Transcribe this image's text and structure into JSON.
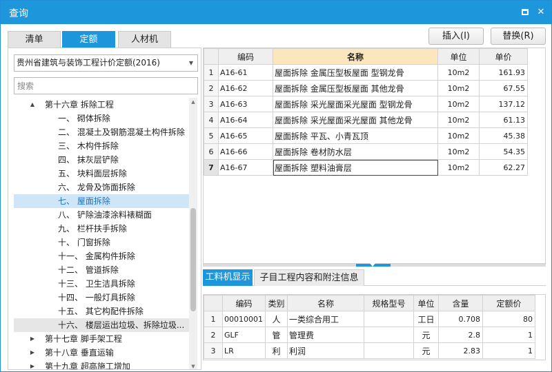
{
  "window": {
    "title": "查询",
    "maximize_icon": "maximize-icon",
    "close_icon": "close-icon",
    "close_glyph": "✕",
    "accent_color": "#1e96dc"
  },
  "tabs": [
    {
      "label": "清单"
    },
    {
      "label": "定额",
      "active": true
    },
    {
      "label": "人材机"
    }
  ],
  "buttons": {
    "insert": "插入(I)",
    "replace": "替换(R)"
  },
  "left": {
    "dropdown_value": "贵州省建筑与装饰工程计价定额(2016)",
    "search_placeholder": "搜索",
    "tree": [
      {
        "label": "第十六章 拆除工程",
        "level": 0,
        "toggle": "▲",
        "expanded": true
      },
      {
        "label": "一、 砌体拆除",
        "level": 1
      },
      {
        "label": "二、 混凝土及钢筋混凝土构件拆除",
        "level": 1
      },
      {
        "label": "三、 木构件拆除",
        "level": 1
      },
      {
        "label": "四、 抹灰层铲除",
        "level": 1
      },
      {
        "label": "五、 块料面层拆除",
        "level": 1
      },
      {
        "label": "六、 龙骨及饰面拆除",
        "level": 1
      },
      {
        "label": "七、 屋面拆除",
        "level": 1,
        "selected": true
      },
      {
        "label": "八、 铲除油漆涂料裱糊面",
        "level": 1
      },
      {
        "label": "九、 栏杆扶手拆除",
        "level": 1
      },
      {
        "label": "十、 门窗拆除",
        "level": 1
      },
      {
        "label": "十一、 金属构件拆除",
        "level": 1
      },
      {
        "label": "十二、 管道拆除",
        "level": 1
      },
      {
        "label": "十三、 卫生洁具拆除",
        "level": 1
      },
      {
        "label": "十四、 一般灯具拆除",
        "level": 1
      },
      {
        "label": "十五、 其它构配件拆除",
        "level": 1
      },
      {
        "label": "十六、 楼层运出垃圾、拆除垃圾...",
        "level": 1,
        "grey": true
      },
      {
        "label": "第十七章 脚手架工程",
        "level": 0,
        "toggle": "▶"
      },
      {
        "label": "第十八章 垂直运输",
        "level": 0,
        "toggle": "▶"
      },
      {
        "label": "第十九章 超高施工增加",
        "level": 0,
        "toggle": "▶"
      }
    ]
  },
  "quota_table": {
    "headers": [
      "编码",
      "名称",
      "单位",
      "单价"
    ],
    "rows": [
      {
        "no": "1",
        "code": "A16-61",
        "name": "屋面拆除 金属压型板屋面 型钢龙骨",
        "unit": "10m2",
        "price": "161.93"
      },
      {
        "no": "2",
        "code": "A16-62",
        "name": "屋面拆除 金属压型板屋面 其他龙骨",
        "unit": "10m2",
        "price": "67.55"
      },
      {
        "no": "3",
        "code": "A16-63",
        "name": "屋面拆除 采光屋面采光屋面 型钢龙骨",
        "unit": "10m2",
        "price": "137.12"
      },
      {
        "no": "4",
        "code": "A16-64",
        "name": "屋面拆除 采光屋面采光屋面 其他龙骨",
        "unit": "10m2",
        "price": "61.13"
      },
      {
        "no": "5",
        "code": "A16-65",
        "name": "屋面拆除 平瓦、小青瓦顶",
        "unit": "10m2",
        "price": "45.38"
      },
      {
        "no": "6",
        "code": "A16-66",
        "name": "屋面拆除 卷材防水层",
        "unit": "10m2",
        "price": "54.35"
      },
      {
        "no": "7",
        "code": "A16-67",
        "name": "屋面拆除 塑料油膏层",
        "unit": "10m2",
        "price": "62.27",
        "current": true
      }
    ]
  },
  "bottom_tabs": [
    {
      "label": "工料机显示",
      "active": true
    },
    {
      "label": "子目工程内容和附注信息"
    }
  ],
  "resource_table": {
    "headers": [
      "编码",
      "类别",
      "名称",
      "规格型号",
      "单位",
      "含量",
      "定额价"
    ],
    "rows": [
      {
        "no": "1",
        "code": "00010001",
        "cat": "人",
        "name": "一类综合用工",
        "spec": "",
        "unit": "工日",
        "qty": "0.708",
        "price": "80"
      },
      {
        "no": "2",
        "code": "GLF",
        "cat": "管",
        "name": "管理费",
        "spec": "",
        "unit": "元",
        "qty": "2.8",
        "price": "1"
      },
      {
        "no": "3",
        "code": "LR",
        "cat": "利",
        "name": "利润",
        "spec": "",
        "unit": "元",
        "qty": "2.83",
        "price": "1"
      }
    ]
  }
}
